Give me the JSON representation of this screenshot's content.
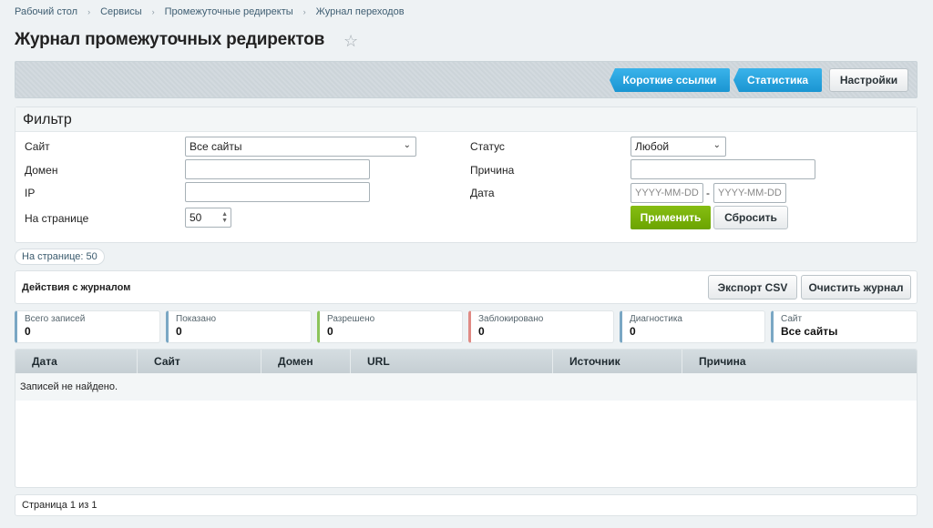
{
  "breadcrumb": [
    "Рабочий стол",
    "Сервисы",
    "Промежуточные редиректы",
    "Журнал переходов"
  ],
  "page_title": "Журнал промежуточных редиректов",
  "toolbar": {
    "short_links": "Короткие ссылки",
    "statistics": "Статистика",
    "settings": "Настройки"
  },
  "filter": {
    "title": "Фильтр",
    "site_label": "Сайт",
    "site_value": "Все сайты",
    "domain_label": "Домен",
    "ip_label": "IP",
    "perpage_label": "На странице",
    "perpage_value": "50",
    "status_label": "Статус",
    "status_value": "Любой",
    "reason_label": "Причина",
    "date_label": "Дата",
    "date_from_placeholder": "YYYY-MM-DD",
    "date_sep": "-",
    "date_to_placeholder": "YYYY-MM-DD",
    "apply": "Применить",
    "reset": "Сбросить"
  },
  "perpage_badge": "На странице: 50",
  "actions": {
    "title": "Действия с журналом",
    "export_csv": "Экспорт CSV",
    "clear": "Очистить журнал"
  },
  "stats": [
    {
      "label": "Всего записей",
      "value": "0",
      "color": "#7aa7c4"
    },
    {
      "label": "Показано",
      "value": "0",
      "color": "#7aa7c4"
    },
    {
      "label": "Разрешено",
      "value": "0",
      "color": "#8cc35a"
    },
    {
      "label": "Заблокировано",
      "value": "0",
      "color": "#e08a84"
    },
    {
      "label": "Диагностика",
      "value": "0",
      "color": "#7aa7c4"
    },
    {
      "label": "Сайт",
      "value": "Все сайты",
      "color": "#7aa7c4"
    }
  ],
  "table": {
    "columns": [
      "Дата",
      "Сайт",
      "Домен",
      "URL",
      "Источник",
      "Причина"
    ],
    "empty_text": "Записей не найдено."
  },
  "pager": "Страница 1 из 1"
}
